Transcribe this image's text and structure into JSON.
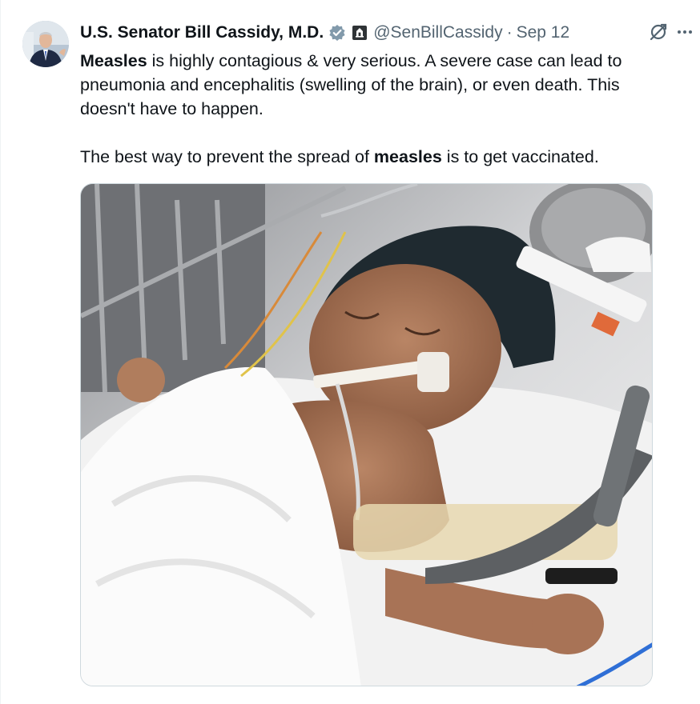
{
  "author": {
    "display_name": "U.S. Senator Bill Cassidy, M.D.",
    "handle": "@SenBillCassidy",
    "separator": "·",
    "date": "Sep 12",
    "verified_icon": "verified-badge-icon",
    "affiliation_icon": "government-label-icon"
  },
  "tweet": {
    "paragraph1": {
      "bold_lead": "Measles",
      "rest": " is highly contagious & very serious. A severe case can lead to pneumonia and encephalitis (swelling of the brain), or even death. This doesn't have to happen."
    },
    "paragraph2": {
      "before": "The best way to prevent the spread of ",
      "bold": "measles",
      "after": " is to get vaccinated."
    }
  },
  "actions": {
    "grok_icon": "grok-icon",
    "more_icon": "more-options-icon"
  },
  "colors": {
    "text": "#0f1419",
    "muted": "#536471",
    "badge": "#829aab",
    "border": "#cfd9de"
  }
}
